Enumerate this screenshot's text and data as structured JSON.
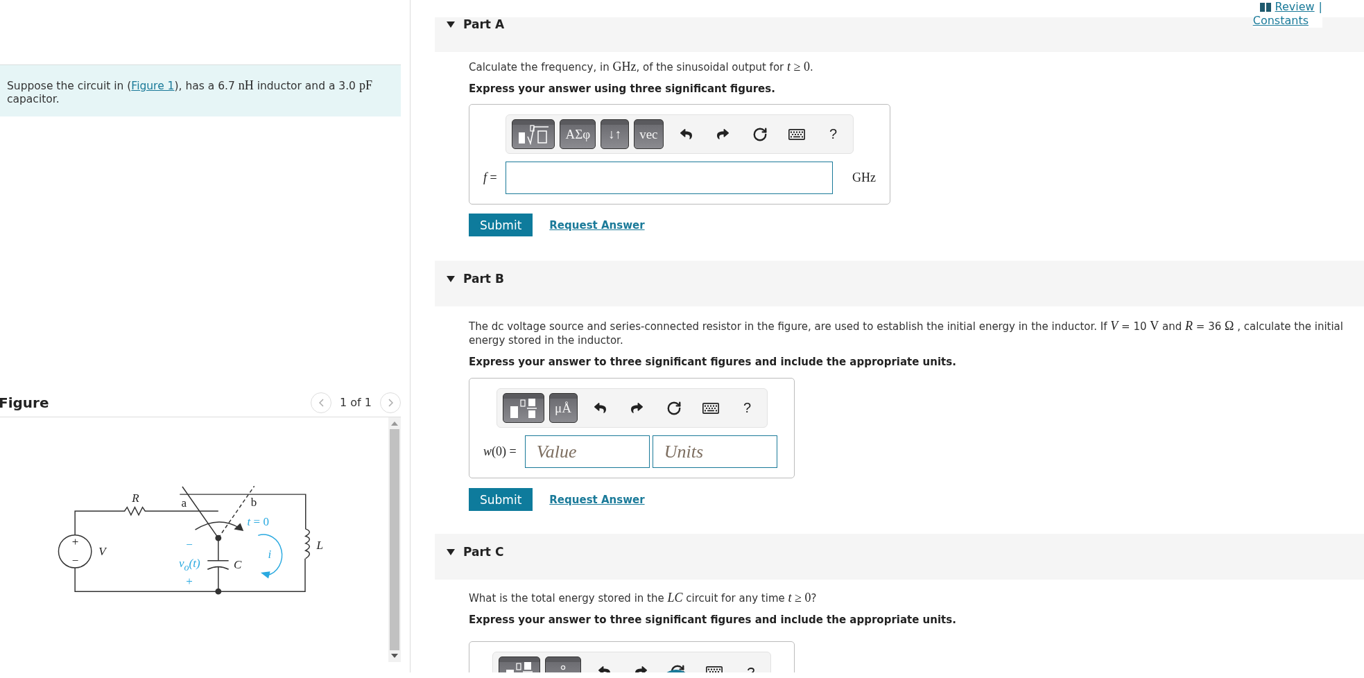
{
  "header": {
    "review_link": "Review",
    "separator": "|",
    "constants_link": "Constants"
  },
  "problem": {
    "intro": [
      {
        "kind": "text",
        "text": "Suppose the circuit in ("
      },
      {
        "kind": "link",
        "text": "Figure 1"
      },
      {
        "kind": "text",
        "text": "), has a 6.7 "
      },
      {
        "kind": "math",
        "text": "nH"
      },
      {
        "kind": "text",
        "text": " inductor and a 3.0 "
      },
      {
        "kind": "math",
        "text": "pF"
      },
      {
        "kind": "text",
        "text": " capacitor."
      }
    ]
  },
  "figure": {
    "title": "Figure",
    "pager": "1 of 1",
    "labels": [
      {
        "text": "R",
        "kind": "symbol"
      },
      {
        "text": "a",
        "kind": "terminal"
      },
      {
        "text": "b",
        "kind": "terminal"
      },
      {
        "text": "*t* = 0",
        "kind": "variable"
      },
      {
        "text": "+",
        "kind": "terminal"
      },
      {
        "text": "−",
        "kind": "terminal"
      },
      {
        "text": "V",
        "kind": "symbol"
      },
      {
        "text": "−",
        "kind": "variable"
      },
      {
        "text": "v$_{o}$(t)",
        "kind": "variable-symbol"
      },
      {
        "text": "+",
        "kind": "variable"
      },
      {
        "text": "C",
        "kind": "symbol"
      },
      {
        "text": "i",
        "kind": "variable-symbol"
      },
      {
        "text": "L",
        "kind": "symbol"
      }
    ]
  },
  "parts": [
    {
      "title": "Part A",
      "expanded": true,
      "question": [
        {
          "kind": "text",
          "text": "Calculate the frequency, in "
        },
        {
          "kind": "math",
          "text": "GHz"
        },
        {
          "kind": "text",
          "text": ", of the sinusoidal output for "
        },
        {
          "kind": "math",
          "text": "*t* ≥ 0"
        },
        {
          "kind": "text",
          "text": "."
        }
      ],
      "instruction": "Express your answer using three significant figures.",
      "answer": {
        "palette": [
          {
            "kind": "templates-root"
          },
          {
            "kind": "text",
            "label": "ΑΣφ"
          },
          {
            "kind": "text",
            "label": "↓↑"
          },
          {
            "kind": "text",
            "label": "vec"
          }
        ],
        "tools": [
          {
            "kind": "undo"
          },
          {
            "kind": "redo"
          },
          {
            "kind": "reset"
          },
          {
            "kind": "keyboard"
          },
          {
            "kind": "help",
            "label": "?"
          }
        ],
        "label": "*f* =",
        "fields": [
          {
            "kind": "blank"
          }
        ],
        "unit": "GHz"
      },
      "submit": "Submit",
      "request": "Request Answer"
    },
    {
      "title": "Part B",
      "expanded": true,
      "question": [
        {
          "kind": "text",
          "text": "The dc voltage source and series-connected resistor in the figure, are used to establish the initial energy in the inductor. If "
        },
        {
          "kind": "math",
          "text": "*V*"
        },
        {
          "kind": "text",
          "text": " = 10 "
        },
        {
          "kind": "math",
          "text": "V"
        },
        {
          "kind": "text",
          "text": " and "
        },
        {
          "kind": "math",
          "text": "*R*"
        },
        {
          "kind": "text",
          "text": " = 36  "
        },
        {
          "kind": "math",
          "text": "Ω"
        },
        {
          "kind": "text",
          "text": " , calculate the initial energy stored in the inductor."
        }
      ],
      "instruction": "Express your answer to three significant figures and include the appropriate units.",
      "answer": {
        "palette": [
          {
            "kind": "templates-fraction"
          },
          {
            "kind": "text",
            "label": "μÅ"
          }
        ],
        "tools": [
          {
            "kind": "undo"
          },
          {
            "kind": "redo"
          },
          {
            "kind": "reset"
          },
          {
            "kind": "keyboard"
          },
          {
            "kind": "help",
            "label": "?"
          }
        ],
        "label": "*w*(0) =",
        "fields": [
          {
            "kind": "value",
            "placeholder": "Value"
          },
          {
            "kind": "units",
            "placeholder": "Units"
          }
        ]
      },
      "submit": "Submit",
      "request": "Request Answer"
    },
    {
      "title": "Part C",
      "expanded": true,
      "question": [
        {
          "kind": "text",
          "text": "What is the total energy stored in the "
        },
        {
          "kind": "math",
          "text": "*LC*"
        },
        {
          "kind": "text",
          "text": " circuit for any time "
        },
        {
          "kind": "math",
          "text": "*t* ≥ 0"
        },
        {
          "kind": "text",
          "text": "?"
        }
      ],
      "instruction": "Express your answer to three significant figures and include the appropriate units.",
      "answer": {
        "palette": [
          {
            "kind": "templates-fraction"
          },
          {
            "kind": "units-cut"
          }
        ],
        "tools": [
          {
            "kind": "undo"
          },
          {
            "kind": "redo"
          },
          {
            "kind": "reset"
          },
          {
            "kind": "keyboard"
          },
          {
            "kind": "help-cut"
          }
        ]
      }
    }
  ]
}
